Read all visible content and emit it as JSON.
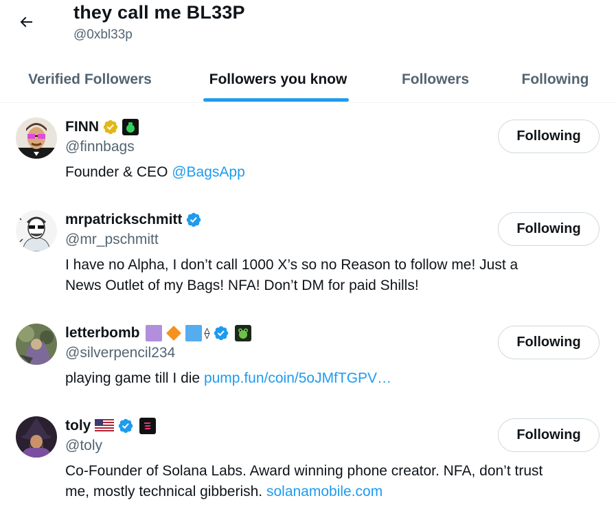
{
  "header": {
    "title": "they call me BL33P",
    "handle": "@0xbl33p"
  },
  "tabs": [
    {
      "label": "Verified Followers",
      "active": false
    },
    {
      "label": "Followers you know",
      "active": true
    },
    {
      "label": "Followers",
      "active": false
    },
    {
      "label": "Following",
      "active": false
    }
  ],
  "accent_color": "#1d9bf0",
  "users": [
    {
      "name": "FINN",
      "handle": "@finnbags",
      "bio_lines": [
        "Founder & CEO "
      ],
      "bio_link": "@BagsApp",
      "button": "Following",
      "badges": [
        "gold-verified-icon",
        "money-bag-icon"
      ]
    },
    {
      "name": "mrpatrickschmitt",
      "handle": "@mr_pschmitt",
      "bio_lines": [
        "I have no Alpha, I don’t call 1000 X’s so no Reason to follow me! Just a",
        "News Outlet of my Bags! NFA! Don’t DM for paid Shills!"
      ],
      "button": "Following",
      "badges": [
        "blue-verified-icon"
      ]
    },
    {
      "name": "letterbomb",
      "handle": "@silverpencil234",
      "bio_lines": [
        "playing game till I die "
      ],
      "bio_link": "pump.fun/coin/5oJMfTGPV…",
      "button": "Following",
      "badges": [
        "purple-square-icon",
        "orange-diamond-icon",
        "blue-square-icon",
        "ethereum-icon",
        "blue-verified-icon",
        "frog-badge-icon"
      ],
      "eth_glyph": "⟠"
    },
    {
      "name": "toly",
      "handle": "@toly",
      "bio_lines": [
        "Co-Founder of Solana Labs. Award winning phone creator. NFA, don’t trust",
        "me, mostly technical gibberish. "
      ],
      "bio_link": "solanamobile.com",
      "button": "Following",
      "badges": [
        "us-flag-icon",
        "blue-verified-icon",
        "solana-badge-icon"
      ]
    }
  ]
}
